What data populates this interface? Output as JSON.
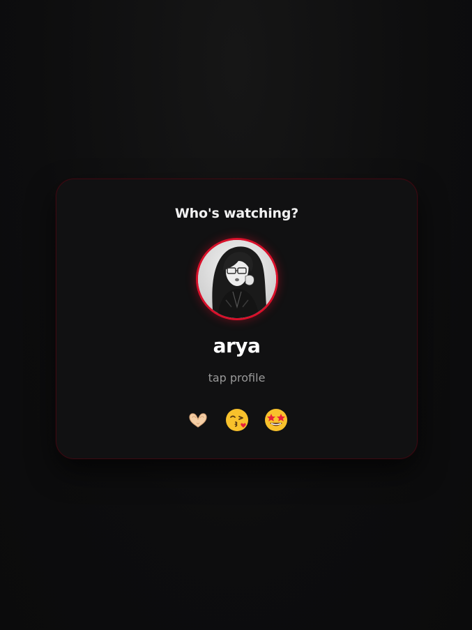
{
  "card": {
    "heading": "Who's watching?",
    "profile": {
      "name": "arya",
      "hint": "tap profile",
      "avatar_icon": "anime-avatar",
      "ring_color": "#d8102a"
    },
    "reactions": [
      {
        "icon": "heart-hands-icon"
      },
      {
        "icon": "kissing-face-icon"
      },
      {
        "icon": "star-struck-face-icon"
      }
    ]
  },
  "colors": {
    "background": "#0e0e0f",
    "card": "#111112",
    "accent": "#d8102a",
    "text": "#ffffff",
    "muted": "#9a9a9a"
  }
}
